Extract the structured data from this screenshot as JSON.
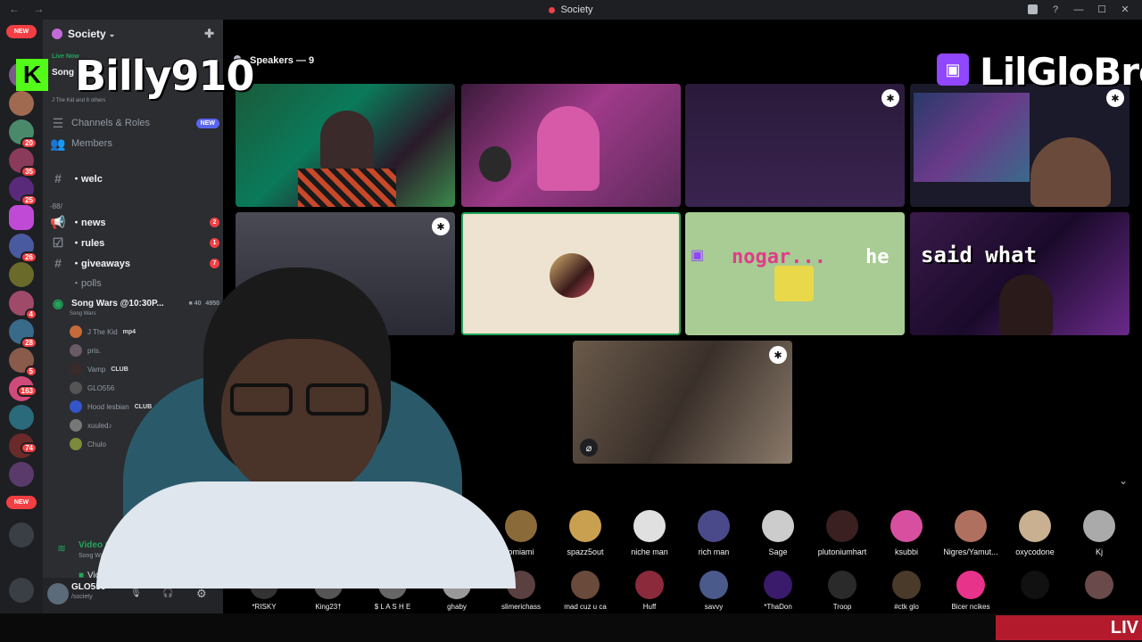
{
  "window": {
    "title": "Society"
  },
  "rail": {
    "new_top": "NEW",
    "new_bottom": "NEW",
    "badges": [
      "2",
      "20",
      "35",
      "25",
      "26",
      "4",
      "28",
      "5",
      "163",
      "78",
      "74",
      "4"
    ]
  },
  "server": {
    "name": "Society",
    "live_now": "Live Now",
    "live_channel": "Song",
    "live_members": "J The Kid and 8 others"
  },
  "sidebar": {
    "channels_roles": "Channels & Roles",
    "channels_roles_tag": "NEW",
    "members": "Members",
    "welcome": "・welc",
    "category": "-88/",
    "news": "・news",
    "news_count": "2",
    "rules": "・rules",
    "rules_count": "1",
    "giveaways": "・giveaways",
    "giveaways_count": "7",
    "polls": "・polls",
    "voice_channel": "Song Wars @10:30P...",
    "voice_channel_sub": "Song Wars",
    "voice_users_count": "40",
    "voice_listeners": "4950"
  },
  "voice_users": [
    {
      "name": "J The Kid",
      "tag": "mp4",
      "color": "#c66a3a"
    },
    {
      "name": "pris.",
      "tag": "",
      "color": "#6a5a66"
    },
    {
      "name": "Vamp",
      "tag": "CLUB",
      "color": "#3a2a2a"
    },
    {
      "name": "GLO556",
      "tag": "",
      "color": "#555"
    },
    {
      "name": "Hood lesbian",
      "tag": "CLUB",
      "color": "#3455c9"
    },
    {
      "name": "xuuled♪",
      "tag": "",
      "color": "#777"
    },
    {
      "name": "Chulo",
      "tag": "",
      "color": "#7a8a3a"
    }
  ],
  "voice_connected": {
    "title": "Video Co",
    "sub": "Song Wars @",
    "video_label": "Video"
  },
  "user_panel": {
    "name": "GLO556",
    "status": "/society"
  },
  "stage": {
    "speakers_label": "Speakers — 9",
    "meme_text_1": "nogar...",
    "meme_text_2": "he",
    "said_what": "said what"
  },
  "audience_row1": [
    {
      "name": "omiami",
      "color": "#8b6a3a"
    },
    {
      "name": "spazz5out",
      "color": "#c9a050"
    },
    {
      "name": "niche man",
      "color": "#e0e0e0"
    },
    {
      "name": "rich man",
      "color": "#4a4a8a"
    },
    {
      "name": "Sage",
      "color": "#ccc"
    },
    {
      "name": "plutoniumhart",
      "color": "#3a2020"
    },
    {
      "name": "ksubbi",
      "color": "#d94fa0"
    },
    {
      "name": "Nigres/Yamut...",
      "color": "#b07060"
    },
    {
      "name": "oxycodone",
      "color": "#c8b090"
    },
    {
      "name": "Kj",
      "color": "#aaa"
    }
  ],
  "audience_row2": [
    {
      "name": "*RISKY",
      "color": "#333"
    },
    {
      "name": "King23†",
      "color": "#555"
    },
    {
      "name": "$ L A S H E",
      "color": "#666"
    },
    {
      "name": "ghaby",
      "color": "#999"
    },
    {
      "name": "slimerichass",
      "color": "#5a4040"
    },
    {
      "name": "mad cuz u ca",
      "color": "#6a4a3a"
    },
    {
      "name": "Huff",
      "color": "#8a2a3a"
    },
    {
      "name": "savvy",
      "color": "#4a5a8a"
    },
    {
      "name": "*ThaDon",
      "color": "#3a1a6a"
    },
    {
      "name": "Troop",
      "color": "#2a2a2a"
    },
    {
      "name": "#ctk glo",
      "color": "#4a3a2a"
    },
    {
      "name": "Bicer ncikes",
      "color": "#e8338a"
    },
    {
      "name": "",
      "color": "#111"
    },
    {
      "name": "",
      "color": "#6a4a4a"
    }
  ],
  "overlay": {
    "streamer_left": "Billy910",
    "streamer_right": "LilGloBro",
    "live_badge": "LIV"
  }
}
